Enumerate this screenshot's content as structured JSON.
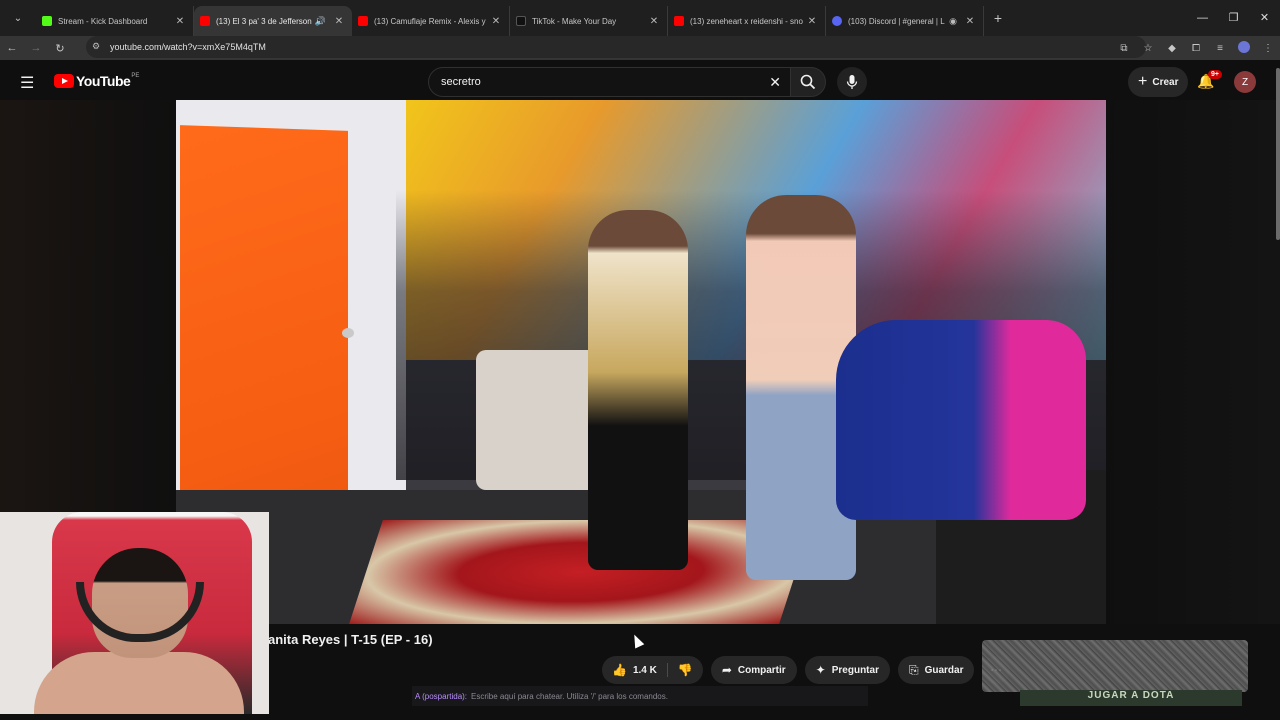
{
  "browser": {
    "tabs": [
      {
        "title": "Stream - Kick Dashboard",
        "favicon_color": "#53fc18",
        "active": false
      },
      {
        "title": "(13) El 3 pa' 3 de Jefferson",
        "favicon_color": "#ff0000",
        "active": true
      },
      {
        "title": "(13) Camuflaje Remix - Alexis y",
        "favicon_color": "#ff0000",
        "active": false
      },
      {
        "title": "TikTok - Make Your Day",
        "favicon_color": "#111111",
        "active": false
      },
      {
        "title": "(13) zeneheart x reidenshi - sno",
        "favicon_color": "#ff0000",
        "active": false
      },
      {
        "title": "(103) Discord | #general | L",
        "favicon_color": "#5865f2",
        "active": false
      }
    ],
    "url": "youtube.com/watch?v=xmXe75M4qTM"
  },
  "youtube": {
    "logo_text": "YouTube",
    "country_code": "PE",
    "search_value": "secretro",
    "create_label": "Crear",
    "notifications_badge": "9+",
    "avatar_letter": "Z"
  },
  "video": {
    "title_visible": "anita Reyes | T-15 (EP - 16)"
  },
  "actions": {
    "like_count": "1.4 K",
    "share_label": "Compartir",
    "ask_label": "Preguntar",
    "save_label": "Guardar"
  },
  "chat_overlay": {
    "user": "A (pospartida):",
    "placeholder": "Escribe aquí para chatear. Utiliza '/' para los comandos."
  },
  "ad_strip_text": "JUGAR A DOTA",
  "colors": {
    "accent_red": "#ff0000",
    "background": "#0f0f0f",
    "pill": "#272727"
  }
}
